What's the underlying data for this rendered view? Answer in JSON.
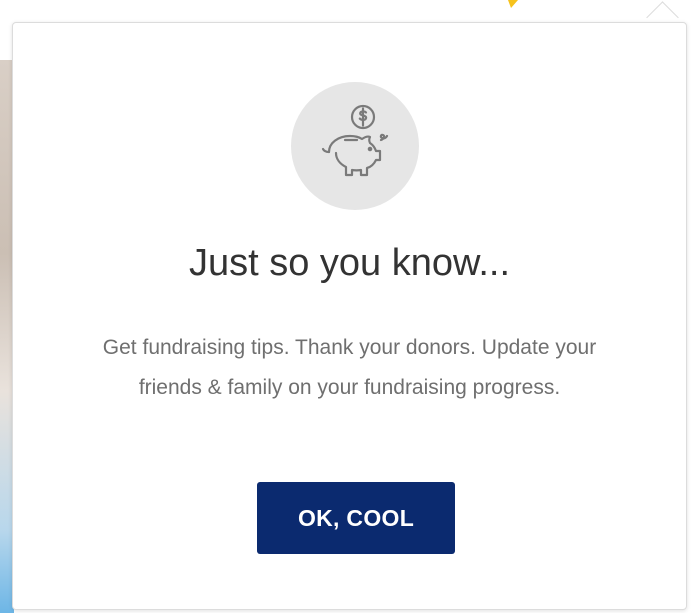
{
  "dialog": {
    "icon": "piggy-bank-coin-icon",
    "title": "Just so you know...",
    "message": "Get fundraising tips. Thank your donors. Update your friends & family on your fundraising progress.",
    "ok_button_label": "OK, COOL"
  },
  "colors": {
    "button_bg": "#0b2a6f",
    "icon_circle_bg": "#e6e6e6",
    "title": "#333333",
    "message": "#6f6f6f"
  }
}
